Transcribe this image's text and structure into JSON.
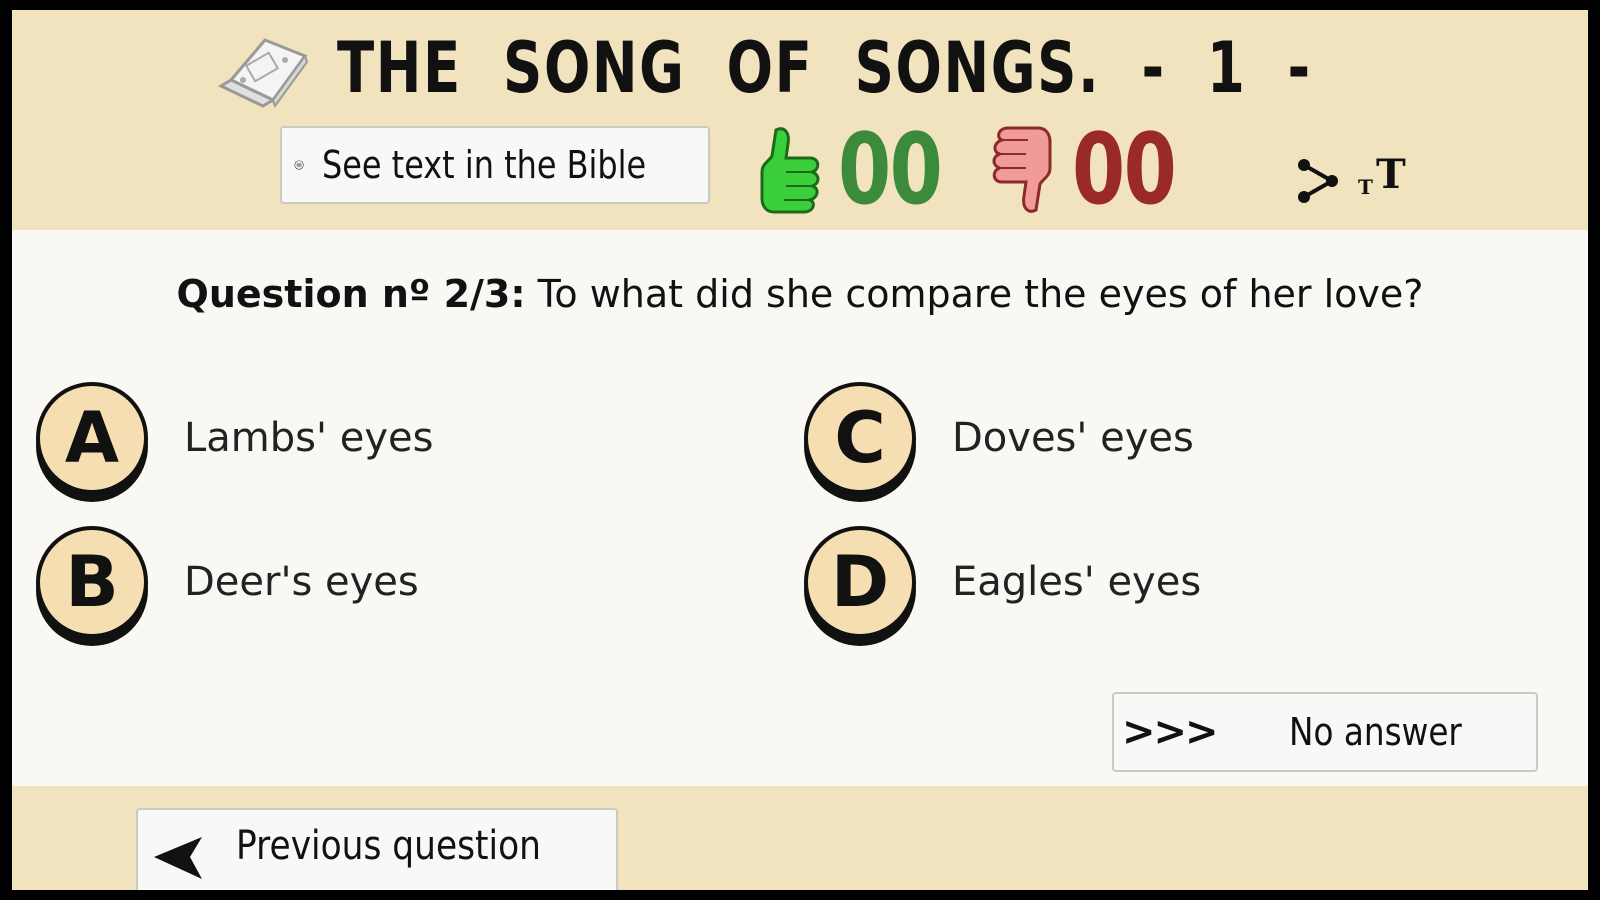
{
  "header": {
    "title": "THE  SONG  OF  SONGS.  -  1  -",
    "bible_button_label": "See text in the Bible",
    "correct_count": "00",
    "wrong_count": "00",
    "correct_color": "#3c8a3c",
    "wrong_color": "#9a2a2a"
  },
  "question": {
    "label": "Question nº 2/3:",
    "text": " To what did she compare the eyes of her love?"
  },
  "options": [
    {
      "letter": "A",
      "text": "Lambs' eyes"
    },
    {
      "letter": "B",
      "text": "Deer's eyes"
    },
    {
      "letter": "C",
      "text": "Doves' eyes"
    },
    {
      "letter": "D",
      "text": "Eagles' eyes"
    }
  ],
  "no_answer": {
    "arrows": ">>>",
    "label": "No answer"
  },
  "footer": {
    "previous_label": "Previous question"
  },
  "icons": {
    "book": "book-icon",
    "bible": "list-icon",
    "thumbs_up": "thumbs-up-icon",
    "thumbs_down": "thumbs-down-icon",
    "share": "share-icon",
    "text_size": "text-size-icon",
    "back": "arrow-left-icon"
  }
}
